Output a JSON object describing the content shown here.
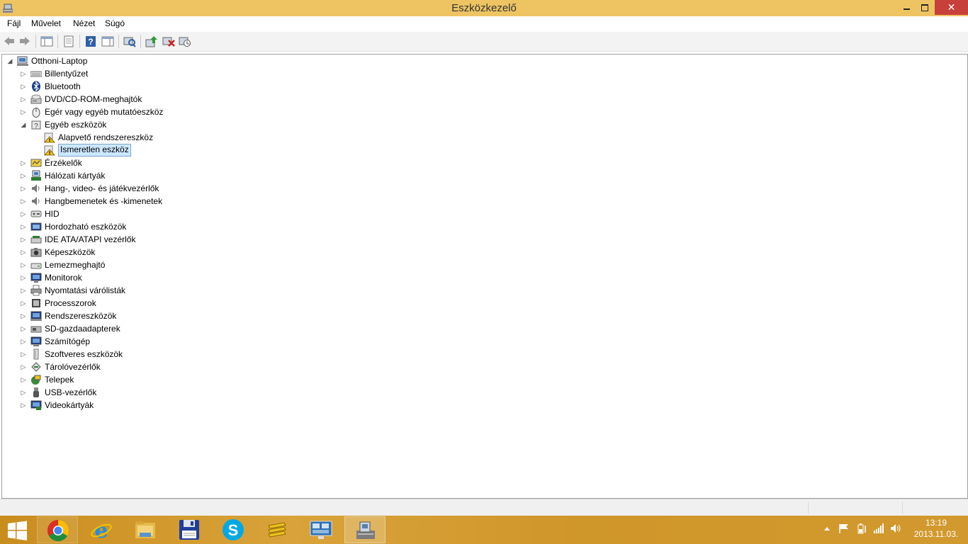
{
  "window": {
    "title": "Eszközkezelő"
  },
  "menu": [
    "Fájl",
    "Művelet",
    "Nézet",
    "Súgó"
  ],
  "tree": {
    "root": "Otthoni-Laptop",
    "categories": [
      {
        "label": "Billentyűzet",
        "icon": "keyboard-icon"
      },
      {
        "label": "Bluetooth",
        "icon": "bluetooth-icon"
      },
      {
        "label": "DVD/CD-ROM-meghajtók",
        "icon": "dvd-drive-icon"
      },
      {
        "label": "Egér vagy egyéb mutatóeszköz",
        "icon": "mouse-icon"
      },
      {
        "label": "Egyéb eszközök",
        "icon": "other-devices-icon",
        "expanded": true,
        "children": [
          {
            "label": "Alapvető rendszereszköz",
            "icon": "warning-device-icon"
          },
          {
            "label": "Ismeretlen eszköz",
            "icon": "warning-device-icon",
            "selected": true
          }
        ]
      },
      {
        "label": "Érzékelők",
        "icon": "sensor-icon"
      },
      {
        "label": "Hálózati kártyák",
        "icon": "network-adapter-icon"
      },
      {
        "label": "Hang-, video- és játékvezérlők",
        "icon": "speaker-icon"
      },
      {
        "label": "Hangbemenetek és -kimenetek",
        "icon": "speaker-icon"
      },
      {
        "label": "HID",
        "icon": "hid-icon"
      },
      {
        "label": "Hordozható eszközök",
        "icon": "portable-device-icon"
      },
      {
        "label": "IDE ATA/ATAPI vezérlők",
        "icon": "ide-controller-icon"
      },
      {
        "label": "Képeszközök",
        "icon": "camera-icon"
      },
      {
        "label": "Lemezmeghajtó",
        "icon": "disk-drive-icon"
      },
      {
        "label": "Monitorok",
        "icon": "monitor-icon"
      },
      {
        "label": "Nyomtatási várólisták",
        "icon": "printer-icon"
      },
      {
        "label": "Processzorok",
        "icon": "processor-icon"
      },
      {
        "label": "Rendszereszközök",
        "icon": "system-device-icon"
      },
      {
        "label": "SD-gazdaadapterek",
        "icon": "sd-adapter-icon"
      },
      {
        "label": "Számítógép",
        "icon": "computer-icon"
      },
      {
        "label": "Szoftveres eszközök",
        "icon": "software-device-icon"
      },
      {
        "label": "Tárolóvezérlők",
        "icon": "storage-controller-icon"
      },
      {
        "label": "Telepek",
        "icon": "battery-icon"
      },
      {
        "label": "USB-vezérlők",
        "icon": "usb-icon"
      },
      {
        "label": "Videokártyák",
        "icon": "display-adapter-icon"
      }
    ]
  },
  "taskbar": {
    "apps": [
      {
        "name": "chrome",
        "icon": "chrome-icon"
      },
      {
        "name": "internet-explorer",
        "icon": "ie-icon"
      },
      {
        "name": "file-explorer",
        "icon": "folder-icon"
      },
      {
        "name": "save-app",
        "icon": "floppy-icon"
      },
      {
        "name": "skype",
        "icon": "skype-icon"
      },
      {
        "name": "paper-app",
        "icon": "papers-icon"
      },
      {
        "name": "remote-desktop",
        "icon": "remote-desktop-icon"
      },
      {
        "name": "device-manager",
        "icon": "device-manager-icon",
        "active": true
      }
    ],
    "clock_time": "13:19",
    "clock_date": "2013.11.03."
  }
}
